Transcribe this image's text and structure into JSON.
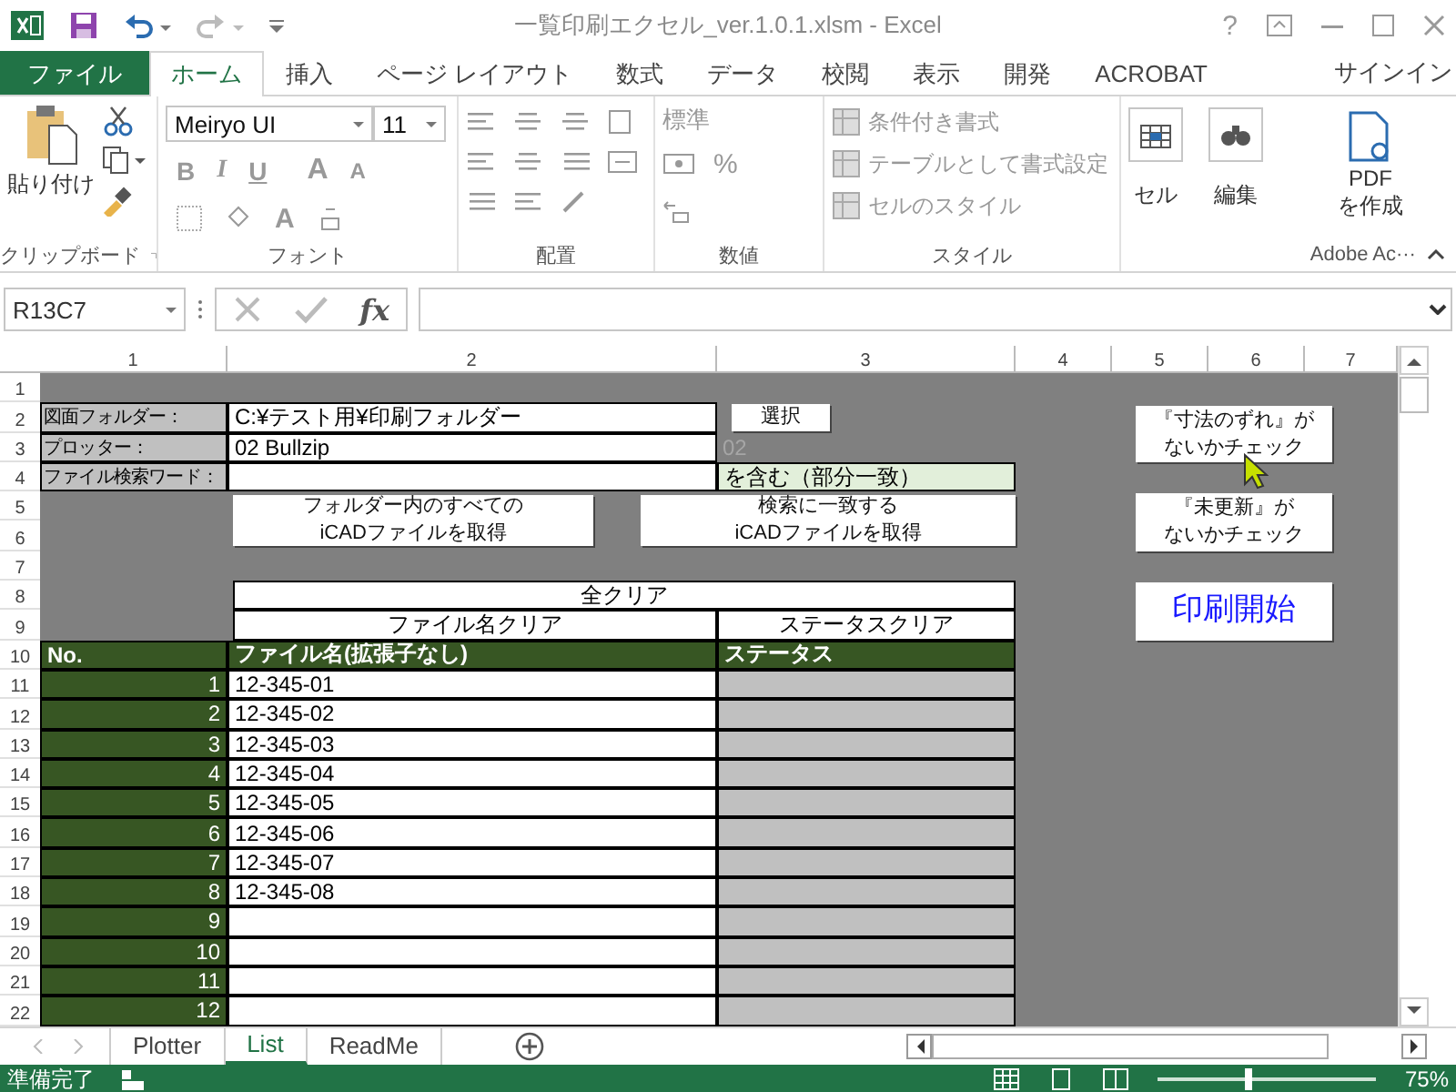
{
  "title_bar": {
    "title": "一覧印刷エクセル_ver.1.0.1.xlsm - Excel",
    "help": "?"
  },
  "ribbon_tabs": [
    {
      "label": "ファイル",
      "kind": "file",
      "selected": false
    },
    {
      "label": "ホーム",
      "kind": "tab",
      "selected": true
    },
    {
      "label": "挿入",
      "kind": "tab",
      "selected": false
    },
    {
      "label": "ページ レイアウト",
      "kind": "tab",
      "selected": false
    },
    {
      "label": "数式",
      "kind": "tab",
      "selected": false
    },
    {
      "label": "データ",
      "kind": "tab",
      "selected": false
    },
    {
      "label": "校閲",
      "kind": "tab",
      "selected": false
    },
    {
      "label": "表示",
      "kind": "tab",
      "selected": false
    },
    {
      "label": "開発",
      "kind": "tab",
      "selected": false
    },
    {
      "label": "ACROBAT",
      "kind": "tab",
      "selected": false
    }
  ],
  "sign_in": "サインイン",
  "ribbon": {
    "clipboard": {
      "paste": "貼り付け",
      "group": "クリップボード"
    },
    "font": {
      "font_name": "Meiryo UI",
      "font_size": "11",
      "bold": "B",
      "italic": "I",
      "underline": "U",
      "grow": "A",
      "shrink": "A",
      "font_color_button": "A",
      "group": "フォント"
    },
    "alignment": {
      "group": "配置"
    },
    "number": {
      "format": "標準",
      "percent": "%",
      "group": "数値"
    },
    "styles": {
      "items": [
        "条件付き書式",
        "テーブルとして書式設定",
        "セルのスタイル"
      ],
      "group": "スタイル"
    },
    "cells": {
      "label": "セル"
    },
    "editing": {
      "label": "編集"
    },
    "adobe": {
      "button": [
        "PDF",
        "を作成"
      ],
      "group": "Adobe Ac···"
    }
  },
  "formula_bar": {
    "name_box": "R13C7",
    "function_label": "fx"
  },
  "column_headers": [
    "1",
    "2",
    "3",
    "4",
    "5",
    "6",
    "7"
  ],
  "row_headers": [
    "1",
    "2",
    "3",
    "4",
    "5",
    "6",
    "7",
    "8",
    "9",
    "10",
    "11",
    "12",
    "13",
    "14",
    "15",
    "16",
    "17",
    "18",
    "19",
    "20",
    "21",
    "22"
  ],
  "sheet": {
    "folder_label": "図面フォルダー：",
    "folder_value": "C:¥テスト用¥印刷フォルダー",
    "select_button": "選択",
    "plotter_label": "プロッター：",
    "plotter_value": "02 Bullzip",
    "plotter_code": "02",
    "search_label": "ファイル検索ワード：",
    "search_suffix": "を含む（部分一致）",
    "get_all_button": [
      "フォルダー内のすべての",
      "iCADファイルを取得"
    ],
    "get_matching_button": [
      "検索に一致する",
      "iCADファイルを取得"
    ],
    "clear_all_button": "全クリア",
    "clear_names_button": "ファイル名クリア",
    "clear_status_button": "ステータスクリア",
    "check_dimension_button": [
      "『寸法のずれ』が",
      "ないかチェック"
    ],
    "check_unupdated_button": [
      "『未更新』が",
      "ないかチェック"
    ],
    "print_button": "印刷開始",
    "table": {
      "columns": [
        "No.",
        "ファイル名(拡張子なし)",
        "ステータス"
      ],
      "rows": [
        {
          "no": "1",
          "file": "12-345-01"
        },
        {
          "no": "2",
          "file": "12-345-02"
        },
        {
          "no": "3",
          "file": "12-345-03"
        },
        {
          "no": "4",
          "file": "12-345-04"
        },
        {
          "no": "5",
          "file": "12-345-05"
        },
        {
          "no": "6",
          "file": "12-345-06"
        },
        {
          "no": "7",
          "file": "12-345-07"
        },
        {
          "no": "8",
          "file": "12-345-08"
        },
        {
          "no": "9"
        },
        {
          "no": "10"
        },
        {
          "no": "11"
        },
        {
          "no": "12"
        }
      ]
    }
  },
  "sheet_tabs": [
    {
      "label": "Plotter",
      "selected": false
    },
    {
      "label": "List",
      "selected": true
    },
    {
      "label": "ReadMe",
      "selected": false
    }
  ],
  "status_bar": {
    "status": "準備完了",
    "zoom": "75%",
    "zoom_slider": {
      "level": 0.42
    }
  }
}
